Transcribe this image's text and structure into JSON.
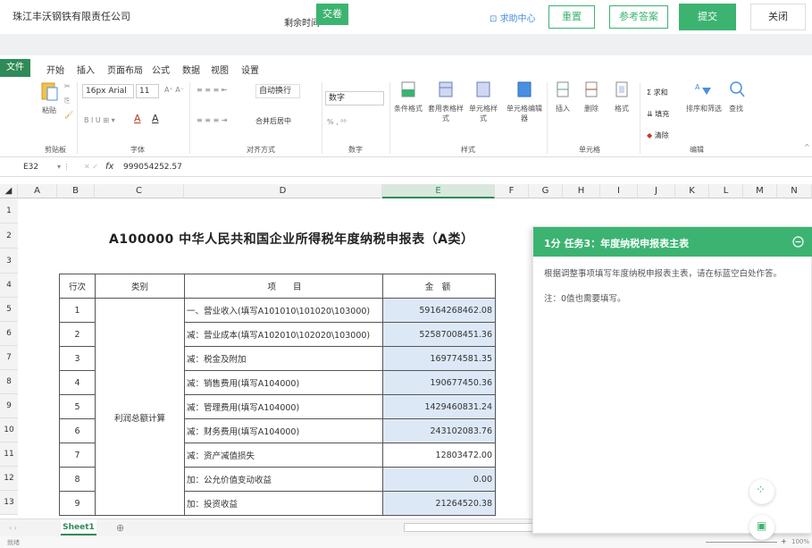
{
  "top": {
    "company": "珠江丰沃钢铁有限责任公司",
    "remain_label": "剩余时间",
    "submit_small": "交卷",
    "help": "求助中心",
    "reset": "重置",
    "reference": "参考答案",
    "submit": "提交",
    "close": "关闭"
  },
  "tabs": [
    "文件",
    "开始",
    "插入",
    "页面布局",
    "公式",
    "数据",
    "视图",
    "设置"
  ],
  "ribbon": {
    "paste": "粘贴",
    "clipboard_group": "剪贴板",
    "font_name": "16px Arial",
    "font_size": "11",
    "font_group": "字体",
    "wrap": "自动换行",
    "merge": "合并后居中",
    "align_group": "对齐方式",
    "number_format": "数字",
    "number_group": "数字",
    "cond_format": "条件格式",
    "table_style": "套用表格样式",
    "cell_style": "单元格样式",
    "cell_editor": "单元格编辑器",
    "style_group": "样式",
    "insert": "插入",
    "delete": "删除",
    "format": "格式",
    "cell_group": "单元格",
    "sum": "求和",
    "fill": "填充",
    "clear": "清除",
    "sort_filter": "排序和筛选",
    "find": "查找",
    "edit_group": "编辑"
  },
  "formula": {
    "cell_ref": "E32",
    "fx": "fx",
    "value": "999054252.57"
  },
  "columns": [
    "A",
    "B",
    "C",
    "D",
    "E",
    "F",
    "G",
    "H",
    "I",
    "J",
    "K",
    "L",
    "M",
    "N"
  ],
  "rows": [
    "1",
    "2",
    "3",
    "4",
    "5",
    "6",
    "7",
    "8",
    "9",
    "10",
    "11",
    "12",
    "13"
  ],
  "sheet": {
    "title": "A100000  中华人民共和国企业所得税年度纳税申报表（A类）",
    "header": {
      "no": "行次",
      "cat": "类别",
      "item": "项　　目",
      "amount": "金　额"
    },
    "category": "利润总额计算",
    "lines": [
      {
        "no": "1",
        "item": "一、营业收入(填写A101010\\101020\\103000)",
        "amount": "59164268462.08"
      },
      {
        "no": "2",
        "item": "减：营业成本(填写A102010\\102020\\103000)",
        "amount": "52587008451.36"
      },
      {
        "no": "3",
        "item": "减：税金及附加",
        "amount": "169774581.35"
      },
      {
        "no": "4",
        "item": "减：销售费用(填写A104000)",
        "amount": "190677450.36"
      },
      {
        "no": "5",
        "item": "减：管理费用(填写A104000)",
        "amount": "1429460831.24"
      },
      {
        "no": "6",
        "item": "减：财务费用(填写A104000)",
        "amount": "243102083.76"
      },
      {
        "no": "7",
        "item": "减：资产减值损失",
        "amount": "12803472.00"
      },
      {
        "no": "8",
        "item": "加：公允价值变动收益",
        "amount": "0.00"
      },
      {
        "no": "9",
        "item": "加：投资收益",
        "amount": "21264520.38"
      }
    ]
  },
  "sheet_tab": "Sheet1",
  "panel": {
    "title": "1分 任务3：年度纳税申报表主表",
    "instruction": "根据调整事项填写年度纳税申报表主表，请在标蓝空白处作答。",
    "note": "注：0值也需要填写。"
  },
  "status": {
    "left": "就绪",
    "zoom": "100%"
  },
  "colors": {
    "accent": "#3cb371",
    "input_cell": "#dde8f7"
  }
}
